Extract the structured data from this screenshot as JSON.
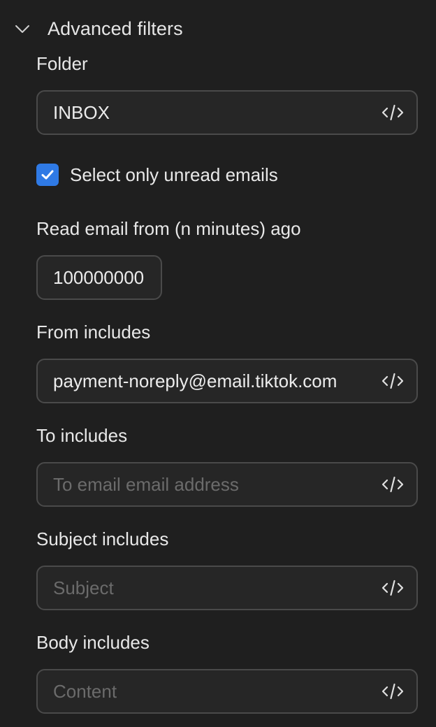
{
  "section": {
    "title": "Advanced filters"
  },
  "folder": {
    "label": "Folder",
    "value": "INBOX"
  },
  "unread": {
    "label": "Select only unread emails",
    "checked": true
  },
  "minutes": {
    "label": "Read email from (n minutes) ago",
    "value": "100000000"
  },
  "from": {
    "label": "From includes",
    "value": "payment-noreply@email.tiktok.com"
  },
  "to": {
    "label": "To includes",
    "placeholder": "To email email address"
  },
  "subject": {
    "label": "Subject includes",
    "placeholder": "Subject"
  },
  "body": {
    "label": "Body includes",
    "placeholder": "Content"
  },
  "colors": {
    "accent": "#2f7ae5",
    "background": "#1f1f1f",
    "field_border": "#4a4a4a"
  },
  "icons": {
    "toggle": "chevron-down-icon",
    "code": "code-icon",
    "check": "checkmark-icon"
  }
}
